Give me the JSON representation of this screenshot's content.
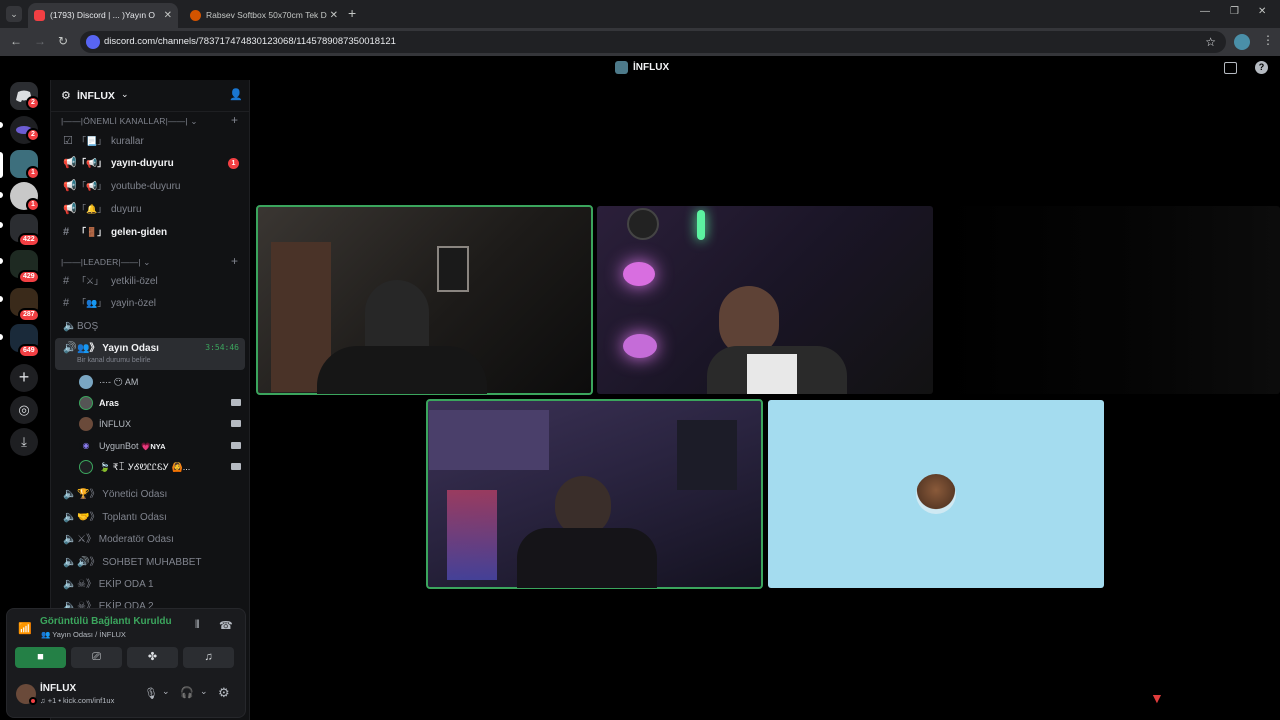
{
  "browser": {
    "tabs": [
      {
        "label": "(1793) Discord | ... )Yayın O",
        "active": true
      },
      {
        "label": "Rabsev Softbox 50x70cm Tek D",
        "active": false
      }
    ],
    "url": "discord.com/channels/783717474830123068/1145789087350018121"
  },
  "topbar": {
    "title": "İNFLUX"
  },
  "rail": {
    "badges": [
      "2",
      "2",
      "1",
      "1",
      "422",
      "429",
      "287",
      "649"
    ]
  },
  "sidebar": {
    "server_name": "İNFLUX",
    "categories": {
      "important": "|——|ÖNEMLİ KANALLAR|——|",
      "leader": "|——|LEADER|——|"
    },
    "channels": [
      {
        "emoji": "「📃」",
        "name": "kurallar"
      },
      {
        "emoji": "「📢」",
        "name": "yayın-duyuru",
        "badge": "1"
      },
      {
        "emoji": "「📢」",
        "name": "youtube-duyuru"
      },
      {
        "emoji": "「🔔」",
        "name": "duyuru"
      },
      {
        "emoji": "「🚪」",
        "name": "gelen-giden"
      },
      {
        "emoji": "「⚔」",
        "name": "yetkili-özel"
      },
      {
        "emoji": "「👥」",
        "name": "yayin-özel"
      },
      {
        "emoji": "",
        "name": "BOŞ"
      },
      {
        "emoji": "👥》",
        "name": "Yayın Odası",
        "timer": "3:54:46",
        "status": "Bir kanal durumu belirle"
      }
    ],
    "voice_users": [
      {
        "name": "·-·- 😶 AM"
      },
      {
        "name": "Aras"
      },
      {
        "name": "İNFLUX"
      },
      {
        "name": "UygunBot",
        "tag": "💗NYA"
      },
      {
        "name": "🍃 ₹ꀤ ᎩᎴᏬᏝᏝᏋᎩ 🙆..."
      }
    ],
    "more_channels": [
      {
        "emoji": "🏆》",
        "name": "Yönetici Odası"
      },
      {
        "emoji": "🤝》",
        "name": "Toplantı Odası"
      },
      {
        "emoji": "⚔》",
        "name": "Moderatör Odası"
      },
      {
        "emoji": "🔊》",
        "name": "SOHBET MUHABBET"
      },
      {
        "emoji": "☠》",
        "name": "EKİP ODA 1"
      },
      {
        "emoji": "☠》",
        "name": "EKİP ODA 2"
      }
    ]
  },
  "voice_panel": {
    "status": "Görüntülü Bağlantı Kuruldu",
    "channel": "👥 Yayın Odası / İNFLUX"
  },
  "user_panel": {
    "name": "İNFLUX",
    "status": "♫ +1 • kick.com/inf1ux"
  },
  "colors": {
    "accent_green": "#3ba55d",
    "danger": "#f23f43",
    "tile_blue": "#a4dcef"
  }
}
